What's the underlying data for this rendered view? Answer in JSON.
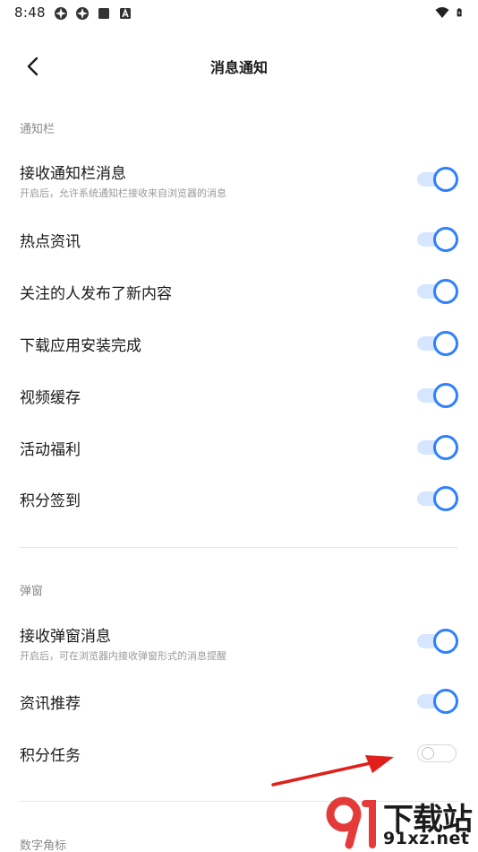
{
  "status_bar": {
    "time": "8:48",
    "left_icons": [
      "app-icon",
      "app-icon",
      "stop-square-icon",
      "a-badge-icon"
    ],
    "right_icons": [
      "wifi-icon",
      "battery-charging-icon"
    ]
  },
  "nav": {
    "title": "消息通知",
    "back_icon": "chevron-left-icon"
  },
  "sections": [
    {
      "title": "通知栏",
      "items": [
        {
          "label": "接收通知栏消息",
          "subtitle": "开启后，允许系统通知栏接收来自浏览器的消息",
          "enabled": true
        },
        {
          "label": "热点资讯",
          "enabled": true
        },
        {
          "label": "关注的人发布了新内容",
          "enabled": true
        },
        {
          "label": "下载应用安装完成",
          "enabled": true
        },
        {
          "label": "视频缓存",
          "enabled": true
        },
        {
          "label": "活动福利",
          "enabled": true
        },
        {
          "label": "积分签到",
          "enabled": true
        }
      ]
    },
    {
      "title": "弹窗",
      "items": [
        {
          "label": "接收弹窗消息",
          "subtitle": "开启后，可在浏览器内接收弹窗形式的消息提醒",
          "enabled": true
        },
        {
          "label": "资讯推荐",
          "enabled": true
        },
        {
          "label": "积分任务",
          "enabled": false
        }
      ]
    },
    {
      "title": "数字角标",
      "items": []
    }
  ],
  "watermark": {
    "text_top": "下载站",
    "text_bottom": "91xz.net"
  },
  "colors": {
    "accent": "#2f80ff",
    "track_on": "#d6e6ff",
    "annotation_arrow": "#e0201c"
  }
}
